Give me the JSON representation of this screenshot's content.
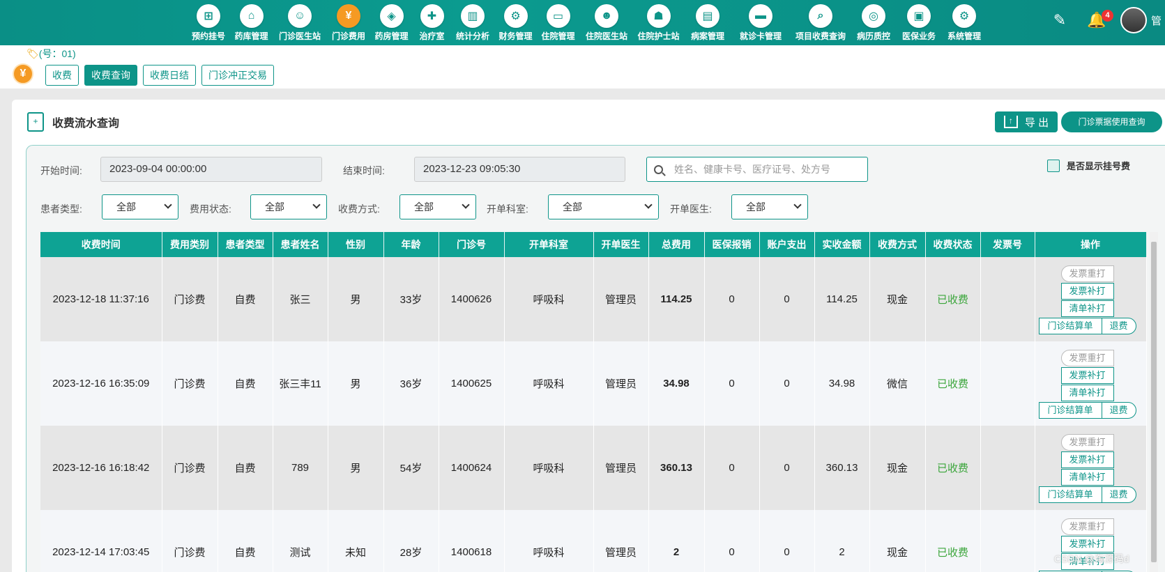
{
  "nav": {
    "items": [
      {
        "label": "预约挂号",
        "icon": "calendar-plus-icon",
        "glyph": "⊞"
      },
      {
        "label": "药库管理",
        "icon": "warehouse-icon",
        "glyph": "⌂"
      },
      {
        "label": "门诊医生站",
        "icon": "doctor-icon",
        "glyph": "☺"
      },
      {
        "label": "门诊费用",
        "icon": "yen-icon",
        "glyph": "¥",
        "active": true
      },
      {
        "label": "药房管理",
        "icon": "pill-icon",
        "glyph": "◈"
      },
      {
        "label": "治疗室",
        "icon": "nurse-icon",
        "glyph": "✚"
      },
      {
        "label": "统计分析",
        "icon": "chart-icon",
        "glyph": "▥"
      },
      {
        "label": "财务管理",
        "icon": "gear-coin-icon",
        "glyph": "⚙"
      },
      {
        "label": "住院管理",
        "icon": "bed-icon",
        "glyph": "▭"
      },
      {
        "label": "住院医生站",
        "icon": "doctor-card-icon",
        "glyph": "☻"
      },
      {
        "label": "住院护士站",
        "icon": "nurse-bed-icon",
        "glyph": "☗"
      },
      {
        "label": "病案管理",
        "icon": "record-icon",
        "glyph": "▤"
      },
      {
        "label": "就诊卡管理",
        "icon": "card-icon",
        "glyph": "▬"
      },
      {
        "label": "项目收费查询",
        "icon": "search-doc-icon",
        "glyph": "⌕"
      },
      {
        "label": "病历质控",
        "icon": "shield-doc-icon",
        "glyph": "◎"
      },
      {
        "label": "医保业务",
        "icon": "insurance-icon",
        "glyph": "▣"
      },
      {
        "label": "系统管理",
        "icon": "settings-icon",
        "glyph": "⚙"
      }
    ]
  },
  "header": {
    "notification_count": "4",
    "user_partial": "管"
  },
  "breadcrumb": "(号：01)",
  "tabs": [
    "收费",
    "收费查询",
    "收费日结",
    "门诊冲正交易"
  ],
  "panel": {
    "title": "收费流水查询",
    "export_label": "导 出",
    "ticket_label": "门诊票据使用查询"
  },
  "filters": {
    "start_label": "开始时间:",
    "start_value": "2023-09-04 00:00:00",
    "end_label": "结束时间:",
    "end_value": "2023-12-23 09:05:30",
    "search_placeholder": "姓名、健康卡号、医疗证号、处方号",
    "show_reg_fee_label": "是否显示挂号费",
    "patient_type_label": "患者类型:",
    "patient_type_value": "全部",
    "fee_status_label": "费用状态:",
    "fee_status_value": "全部",
    "pay_method_label": "收费方式:",
    "pay_method_value": "全部",
    "dept_label": "开单科室:",
    "dept_value": "全部",
    "doctor_label": "开单医生:",
    "doctor_value": "全部"
  },
  "table": {
    "columns": [
      "收费时间",
      "费用类别",
      "患者类型",
      "患者姓名",
      "性别",
      "年龄",
      "门诊号",
      "开单科室",
      "开单医生",
      "总费用",
      "医保报销",
      "账户支出",
      "实收金额",
      "收费方式",
      "收费状态",
      "发票号",
      "操作"
    ],
    "rows": [
      {
        "time": "2023-12-18 11:37:16",
        "category": "门诊费",
        "ptype": "自费",
        "name": "张三",
        "gender": "男",
        "age": "33岁",
        "clinic_no": "1400626",
        "dept": "呼吸科",
        "doctor": "管理员",
        "total": "114.25",
        "insurance": "0",
        "account": "0",
        "received": "114.25",
        "method": "现金",
        "status": "已收费",
        "invoice": ""
      },
      {
        "time": "2023-12-16 16:35:09",
        "category": "门诊费",
        "ptype": "自费",
        "name": "张三丰11",
        "gender": "男",
        "age": "36岁",
        "clinic_no": "1400625",
        "dept": "呼吸科",
        "doctor": "管理员",
        "total": "34.98",
        "insurance": "0",
        "account": "0",
        "received": "34.98",
        "method": "微信",
        "status": "已收费",
        "invoice": ""
      },
      {
        "time": "2023-12-16 16:18:42",
        "category": "门诊费",
        "ptype": "自费",
        "name": "789",
        "gender": "男",
        "age": "54岁",
        "clinic_no": "1400624",
        "dept": "呼吸科",
        "doctor": "管理员",
        "total": "360.13",
        "insurance": "0",
        "account": "0",
        "received": "360.13",
        "method": "现金",
        "status": "已收费",
        "invoice": ""
      },
      {
        "time": "2023-12-14 17:03:45",
        "category": "门诊费",
        "ptype": "自费",
        "name": "测试",
        "gender": "未知",
        "age": "28岁",
        "clinic_no": "1400618",
        "dept": "呼吸科",
        "doctor": "管理员",
        "total": "2",
        "insurance": "0",
        "account": "0",
        "received": "2",
        "method": "现金",
        "status": "已收费",
        "invoice": ""
      }
    ],
    "actions": {
      "reprint": "发票重打",
      "supplement": "发票补打",
      "list_print": "清单补打",
      "settlement": "门诊结算单",
      "refund": "退费"
    }
  },
  "watermark": "CSDN @淘源码d",
  "colors": {
    "accent": "#0d9488",
    "active_nav": "#f59a23",
    "paid": "#3aa53a"
  }
}
